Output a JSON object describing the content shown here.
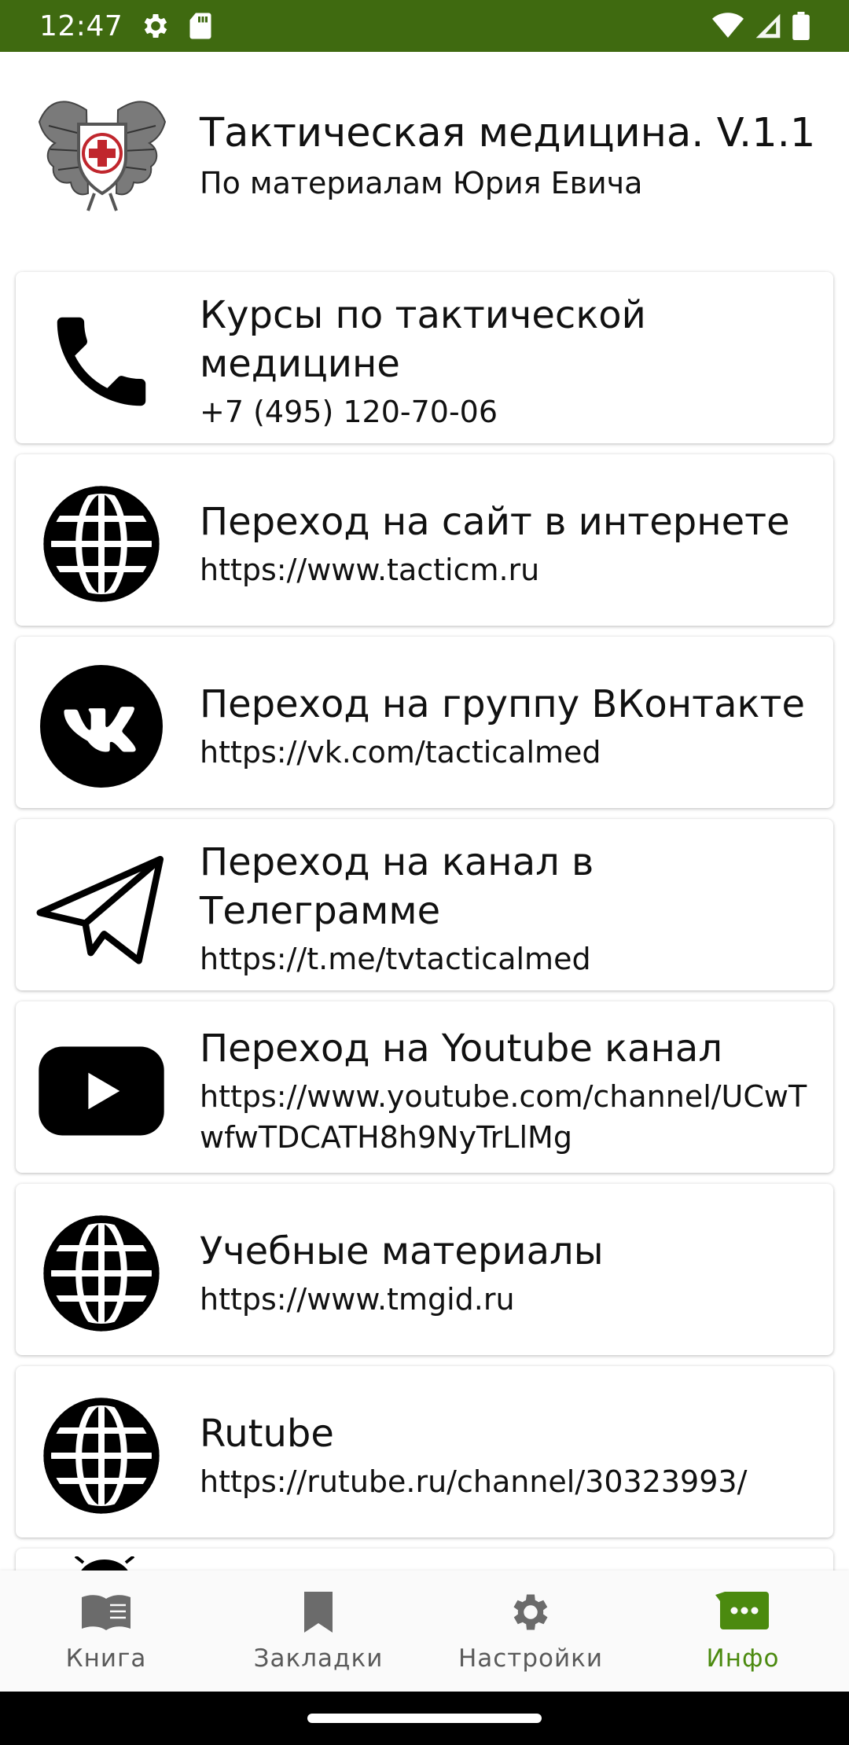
{
  "status_bar": {
    "time": "12:47"
  },
  "header": {
    "title": "Тактическая медицина. V.1.1",
    "subtitle": "По материалам Юрия Евича"
  },
  "cards": [
    {
      "icon": "phone-icon",
      "title": "Курсы по тактической медицине",
      "subtitle": "+7 (495) 120-70-06"
    },
    {
      "icon": "globe-icon",
      "title": "Переход на сайт в интернете",
      "subtitle": "https://www.tacticm.ru"
    },
    {
      "icon": "vk-icon",
      "title": "Переход на группу ВКонтакте",
      "subtitle": "https://vk.com/tacticalmed"
    },
    {
      "icon": "telegram-icon",
      "title": "Переход на канал в Телеграмме",
      "subtitle": "https://t.me/tvtacticalmed"
    },
    {
      "icon": "youtube-icon",
      "title": "Переход на Youtube канал",
      "subtitle": "https://www.youtube.com/channel/UCwTwfwTDCATH8h9NyTrLlMg"
    },
    {
      "icon": "globe-icon",
      "title": "Учебные материалы",
      "subtitle": "https://www.tmgid.ru"
    },
    {
      "icon": "globe-icon",
      "title": "Rutube",
      "subtitle": "https://rutube.ru/channel/30323993/"
    }
  ],
  "bottom_nav": [
    {
      "icon": "book-icon",
      "label": "Книга",
      "active": false
    },
    {
      "icon": "bookmark-icon",
      "label": "Закладки",
      "active": false
    },
    {
      "icon": "gear-icon",
      "label": "Настройки",
      "active": false
    },
    {
      "icon": "info-chat-icon",
      "label": "Инфо",
      "active": true
    }
  ],
  "colors": {
    "status_bar": "#3f6a10",
    "active_nav": "#4b8a0f",
    "inactive_nav": "#5a5a5a"
  }
}
